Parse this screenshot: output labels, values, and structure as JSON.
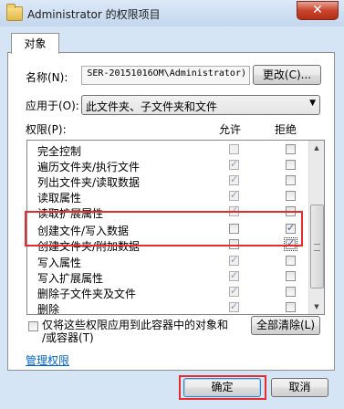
{
  "window": {
    "title": "Administrator 的权限项目",
    "close_glyph": "✕"
  },
  "tabs": [
    {
      "label": "对象"
    }
  ],
  "name": {
    "label": "名称(N):",
    "value": "SER-20151016OM\\Administrator)",
    "change_button": "更改(C)..."
  },
  "apply_to": {
    "label": "应用于(O):",
    "value": "此文件夹、子文件夹和文件"
  },
  "permissions": {
    "label": "权限(P):",
    "allow_header": "允许",
    "deny_header": "拒绝",
    "items": [
      {
        "name": "完全控制",
        "allow": false,
        "deny": false
      },
      {
        "name": "遍历文件夹/执行文件",
        "allow": true,
        "deny": false
      },
      {
        "name": "列出文件夹/读取数据",
        "allow": true,
        "deny": false
      },
      {
        "name": "读取属性",
        "allow": true,
        "deny": false
      },
      {
        "name": "读取扩展属性",
        "allow": true,
        "deny": false
      },
      {
        "name": "创建文件/写入数据",
        "allow": false,
        "deny": true
      },
      {
        "name": "创建文件夹/附加数据",
        "allow": false,
        "deny": true
      },
      {
        "name": "写入属性",
        "allow": true,
        "deny": false
      },
      {
        "name": "写入扩展属性",
        "allow": true,
        "deny": false
      },
      {
        "name": "删除子文件夹及文件",
        "allow": true,
        "deny": false
      },
      {
        "name": "删除",
        "allow": true,
        "deny": false
      }
    ]
  },
  "inherit_option": {
    "label_line1": "仅将这些权限应用到此容器中的对象和",
    "label_line2": "/或容器(T)",
    "checked": false
  },
  "clear_all_button": "全部清除(L)",
  "manage_link": "管理权限",
  "ok_button": "确定",
  "cancel_button": "取消",
  "colors": {
    "highlight": "#e52d2d",
    "link": "#0066cc"
  }
}
